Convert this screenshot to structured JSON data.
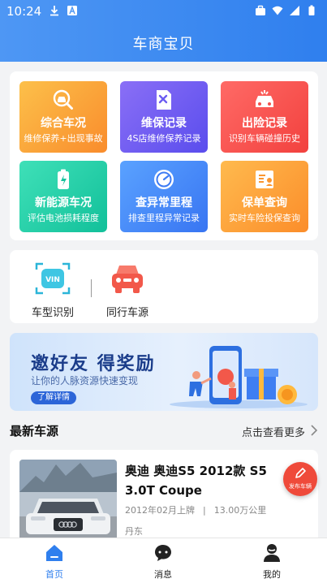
{
  "status_bar": {
    "time": "10:24"
  },
  "app": {
    "title": "车商宝贝"
  },
  "service_grid": [
    {
      "title": "综合车况",
      "subtitle": "维修保养+出现事故",
      "icon": "car-search-icon",
      "color_from": "#fcc04a",
      "color_to": "#f98c2c"
    },
    {
      "title": "维保记录",
      "subtitle": "4S店维修保养记录",
      "icon": "maintenance-doc-icon",
      "color_from": "#8a6ff6",
      "color_to": "#5a4ded"
    },
    {
      "title": "出险记录",
      "subtitle": "识别车辆碰撞历史",
      "icon": "car-crash-icon",
      "color_from": "#ff6a66",
      "color_to": "#f2413e"
    },
    {
      "title": "新能源车况",
      "subtitle": "评估电池损耗程度",
      "icon": "battery-icon",
      "color_from": "#3fe0b8",
      "color_to": "#12c09a"
    },
    {
      "title": "查异常里程",
      "subtitle": "排查里程异常记录",
      "icon": "odometer-icon",
      "color_from": "#5aa2ff",
      "color_to": "#3875f2"
    },
    {
      "title": "保单查询",
      "subtitle": "实时车险投保查询",
      "icon": "insurance-policy-icon",
      "color_from": "#ffba4e",
      "color_to": "#fb8d2a"
    }
  ],
  "quick_actions": [
    {
      "label": "车型识别",
      "icon": "vin-scan-icon"
    },
    {
      "label": "同行车源",
      "icon": "car-front-icon"
    }
  ],
  "banner": {
    "title": "邀好友 得奖励",
    "subtitle": "让你的人脉资源快速变现",
    "button": "了解详情"
  },
  "section": {
    "title": "最新车源",
    "more": "点击查看更多"
  },
  "listing": {
    "name": "奥迪 奥迪S5 2012款 S5 3.0T Coupe",
    "registered": "2012年02月上牌",
    "separator": "|",
    "mileage": "13.00万公里",
    "city": "丹东"
  },
  "fab": {
    "label": "发布车辆"
  },
  "tabbar": [
    {
      "label": "首页",
      "icon": "home-icon",
      "active": true
    },
    {
      "label": "消息",
      "icon": "message-icon",
      "active": false
    },
    {
      "label": "我的",
      "icon": "profile-icon",
      "active": false
    }
  ],
  "colors": {
    "primary": "#2f7fee",
    "accent_red": "#ef4a3a",
    "background": "#f2f3f5"
  }
}
